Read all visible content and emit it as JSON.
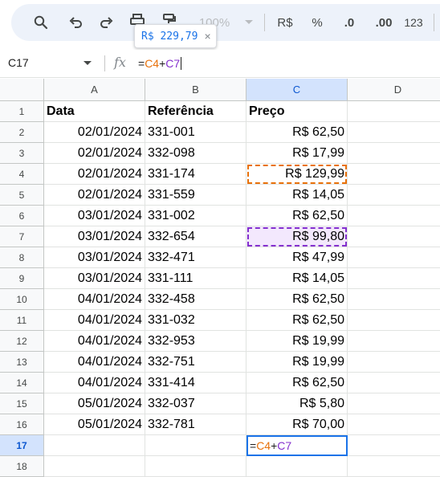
{
  "toolbar": {
    "zoom": "100%",
    "currency_label": "R$",
    "percent_label": "%",
    "decrease_decimals_label": ".0",
    "increase_decimals_label": ".00",
    "more_formats_label": "123",
    "icons": [
      "search-icon",
      "undo-icon",
      "redo-icon",
      "print-icon",
      "paint-format-icon",
      "chevron-down-icon"
    ]
  },
  "tooltip": {
    "value": "R$ 229,79",
    "close": "×"
  },
  "formula_bar": {
    "cell_ref": "C17",
    "fx": "fx",
    "formula_eq": "=",
    "ref1": "C4",
    "op": "+",
    "ref2": "C7"
  },
  "columns": [
    "A",
    "B",
    "C",
    "D"
  ],
  "row_numbers": [
    "1",
    "2",
    "3",
    "4",
    "5",
    "6",
    "7",
    "8",
    "9",
    "10",
    "11",
    "12",
    "13",
    "14",
    "15",
    "16",
    "17",
    "18"
  ],
  "headers": {
    "a": "Data",
    "b": "Referência",
    "c": "Preço"
  },
  "rows": [
    {
      "a": "02/01/2024",
      "b": "331-001",
      "c": "R$ 62,50"
    },
    {
      "a": "02/01/2024",
      "b": "332-098",
      "c": "R$ 17,99"
    },
    {
      "a": "02/01/2024",
      "b": "331-174",
      "c": "R$ 129,99"
    },
    {
      "a": "02/01/2024",
      "b": "331-559",
      "c": "R$ 14,05"
    },
    {
      "a": "03/01/2024",
      "b": "331-002",
      "c": "R$ 62,50"
    },
    {
      "a": "03/01/2024",
      "b": "332-654",
      "c": "R$ 99,80"
    },
    {
      "a": "03/01/2024",
      "b": "332-471",
      "c": "R$ 47,99"
    },
    {
      "a": "03/01/2024",
      "b": "331-111",
      "c": "R$ 14,05"
    },
    {
      "a": "04/01/2024",
      "b": "332-458",
      "c": "R$ 62,50"
    },
    {
      "a": "04/01/2024",
      "b": "331-032",
      "c": "R$ 62,50"
    },
    {
      "a": "04/01/2024",
      "b": "332-953",
      "c": "R$ 19,99"
    },
    {
      "a": "04/01/2024",
      "b": "332-751",
      "c": "R$ 19,99"
    },
    {
      "a": "04/01/2024",
      "b": "331-414",
      "c": "R$ 62,50"
    },
    {
      "a": "05/01/2024",
      "b": "332-037",
      "c": "R$ 5,80"
    },
    {
      "a": "05/01/2024",
      "b": "332-781",
      "c": "R$ 70,00"
    }
  ],
  "active_cell": {
    "ref": "C17",
    "formula_eq": "=",
    "ref1": "C4",
    "op": "+",
    "ref2": "C7"
  },
  "colors": {
    "ref1": "#e8710a",
    "ref2": "#8430ce",
    "selection": "#1a73e8",
    "header_active": "#d3e3fd"
  }
}
